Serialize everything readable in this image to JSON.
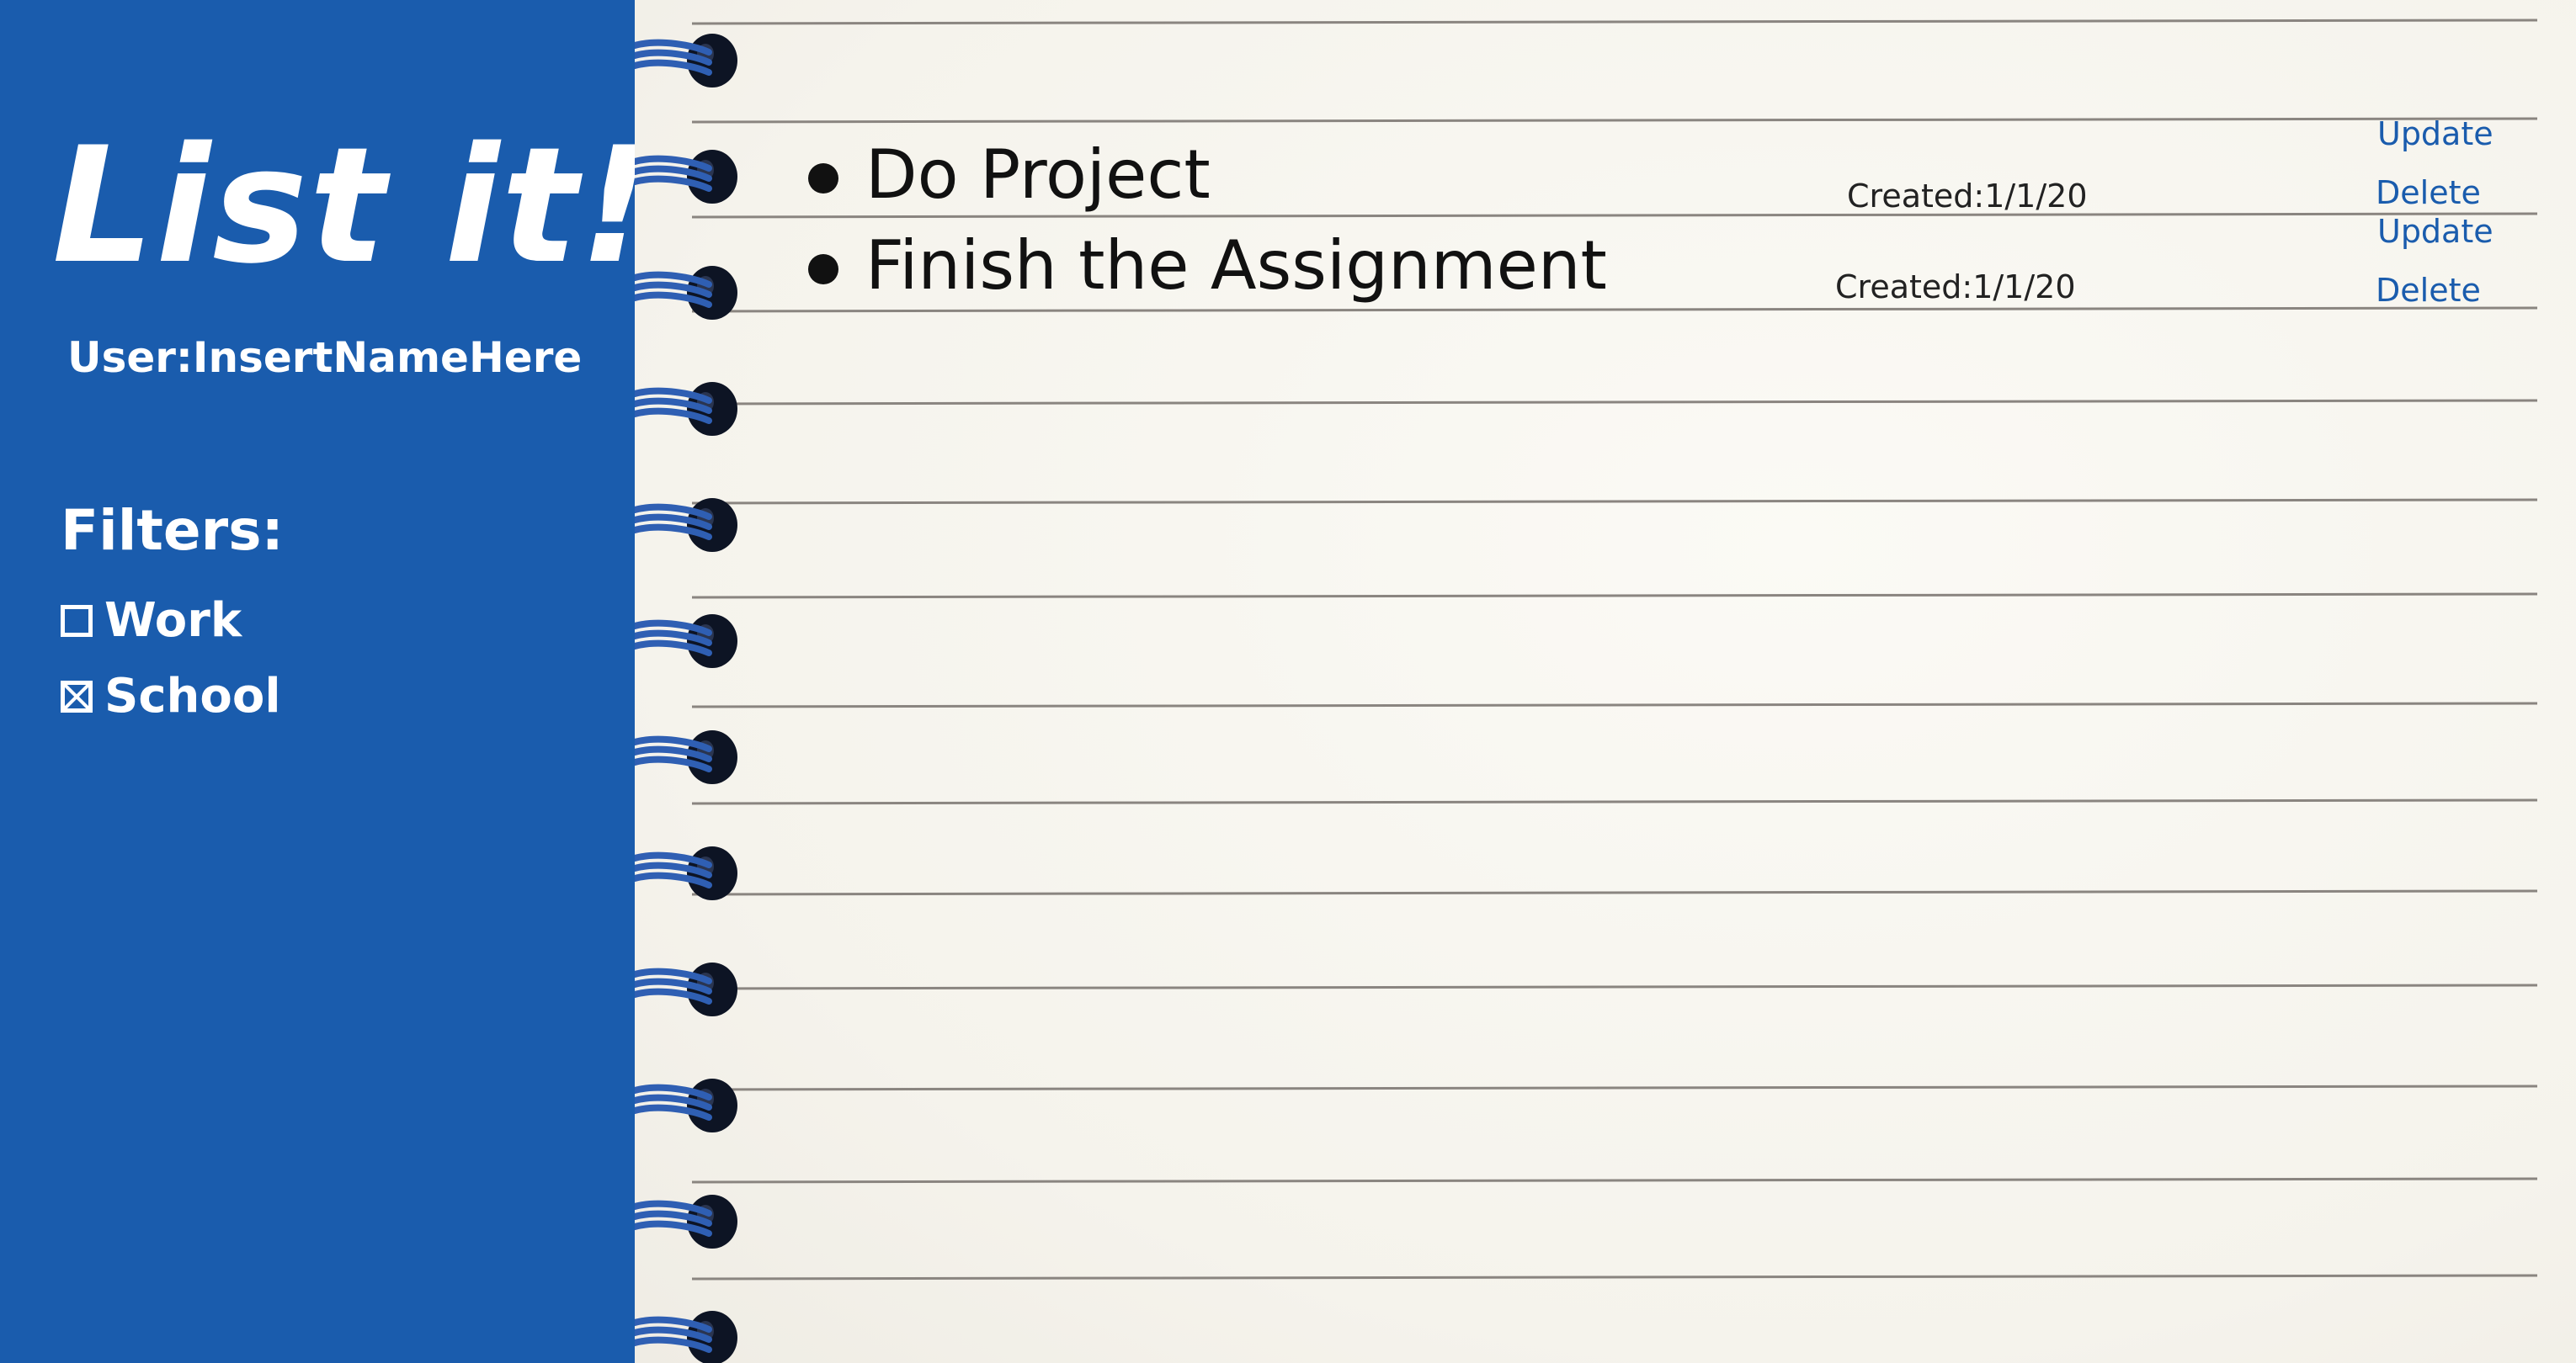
{
  "sidebar": {
    "title": "List it!",
    "user_label": "User:InsertNameHere",
    "filters_heading": "Filters:",
    "filters": [
      {
        "label": "Work",
        "checked": false
      },
      {
        "label": "School",
        "checked": true
      }
    ]
  },
  "tasks": [
    {
      "title": "Do Project",
      "created": "Created:1/1/20",
      "update_label": "Update",
      "delete_label": "Delete"
    },
    {
      "title": "Finish the Assignment",
      "created": "Created:1/1/20",
      "update_label": "Update",
      "delete_label": "Delete"
    }
  ],
  "colors": {
    "sidebar_bg": "#1a5cad",
    "link": "#1a5cad",
    "paper": "#f8f6f0",
    "rule_line": "#8a8580",
    "spiral_wire": "#2f5fb3",
    "spiral_hole": "#0d1424"
  },
  "icons": {
    "bullet": "bullet-icon",
    "unchecked": "checkbox-empty-icon",
    "checked": "checkbox-checked-icon"
  }
}
